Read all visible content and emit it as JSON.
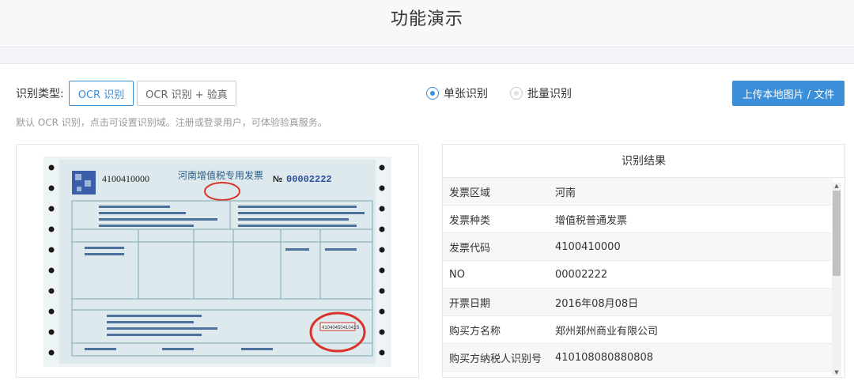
{
  "page": {
    "title": "功能演示"
  },
  "controls": {
    "type_label": "识别类型:",
    "types": [
      "OCR 识别",
      "OCR 识别 + 验真"
    ],
    "modes": [
      "单张识别",
      "批量识别"
    ],
    "upload_label": "上传本地图片 / 文件",
    "hint": "默认 OCR 识别，点击可设置识别域。注册或登录用户，可体验验真服务。"
  },
  "invoice_image": {
    "code": "4100410000",
    "title": "河南增值税专用发票",
    "number_prefix": "№",
    "number": "00002222",
    "seal_text": "4104045041041S"
  },
  "result": {
    "title": "识别结果",
    "rows": [
      {
        "key": "发票区域",
        "value": "河南"
      },
      {
        "key": "发票种类",
        "value": "增值税普通发票"
      },
      {
        "key": "发票代码",
        "value": "4100410000"
      },
      {
        "key": "NO",
        "value": "00002222"
      },
      {
        "key": "开票日期",
        "value": "2016年08月08日"
      },
      {
        "key": "购买方名称",
        "value": "郑州郑州商业有限公司"
      },
      {
        "key": "购买方纳税人识别号",
        "value": "410108080880808"
      }
    ]
  },
  "colors": {
    "accent": "#3b8ed8",
    "seal": "#d9342b",
    "invoice_bg": "#dde9ec"
  }
}
